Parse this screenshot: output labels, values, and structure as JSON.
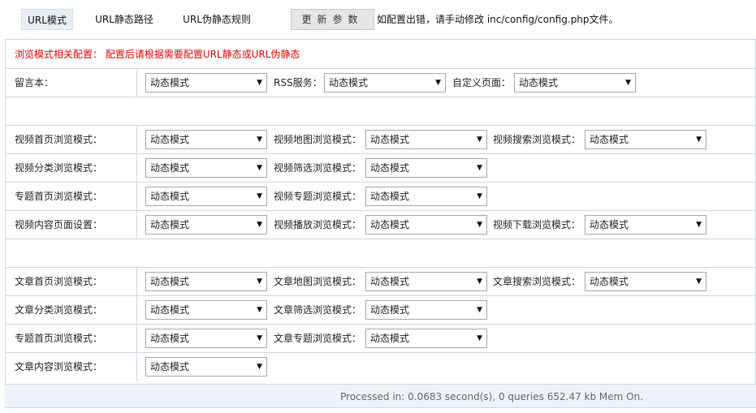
{
  "tabs": [
    "URL模式",
    "URL静态路径",
    "URL伪静态规则"
  ],
  "update_button": "更新参数",
  "tip": "如配置出错，请手动修改 inc/config/config.php文件。",
  "notice": "浏览模式相关配置： 配置后请根据需要配置URL静态或URL伪静态",
  "option": "动态模式",
  "labels": {
    "guestbook": "留言本：",
    "rss": "RSS服务：",
    "custom": "自定义页面：",
    "vod_index": "视频首页浏览模式：",
    "vod_map": "视频地图浏览模式：",
    "vod_search": "视频搜索浏览模式：",
    "vod_type": "视频分类浏览模式：",
    "vod_filter": "视频筛选浏览模式：",
    "vod_topic_index": "专题首页浏览模式：",
    "vod_topic": "视频专题浏览模式：",
    "vod_detail": "视频内容页面设置：",
    "vod_play": "视频播放浏览模式：",
    "vod_down": "视频下载浏览模式：",
    "art_index": "文章首页浏览模式：",
    "art_map": "文章地图浏览模式：",
    "art_search": "文章搜索浏览模式：",
    "art_type": "文章分类浏览模式：",
    "art_filter": "文章筛选浏览模式：",
    "art_topic_index": "专题首页浏览模式：",
    "art_topic": "文章专题浏览模式：",
    "art_detail": "文章内容浏览模式："
  },
  "footer": "Processed in: 0.0683 second(s), 0 queries 652.47 kb Mem On."
}
